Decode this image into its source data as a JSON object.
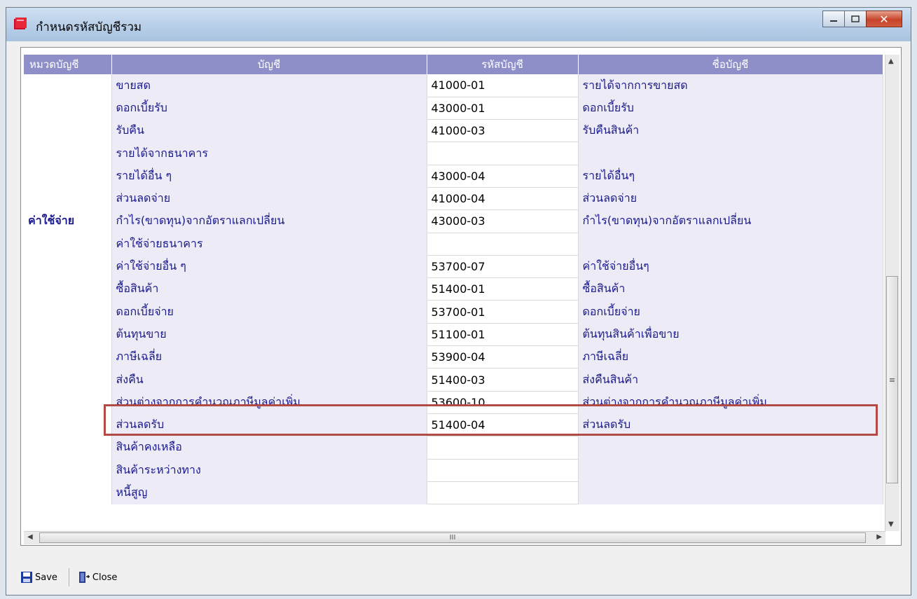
{
  "window": {
    "title": "กำหนดรหัสบัญชีรวม"
  },
  "columns": [
    "หมวดบัญชี",
    "บัญชี",
    "รหัสบัญชี",
    "ชื่อบัญชี"
  ],
  "rows": [
    {
      "cat": "",
      "acct": "ขายสด",
      "code": "41000-01",
      "name": "รายได้จากการขายสด"
    },
    {
      "cat": "",
      "acct": "ดอกเบี้ยรับ",
      "code": "43000-01",
      "name": "ดอกเบี้ยรับ"
    },
    {
      "cat": "",
      "acct": "รับคืน",
      "code": "41000-03",
      "name": "รับคืนสินค้า"
    },
    {
      "cat": "",
      "acct": "รายได้จากธนาคาร",
      "code": "",
      "name": ""
    },
    {
      "cat": "",
      "acct": "รายได้อื่น ๆ",
      "code": "43000-04",
      "name": "รายได้อื่นๆ"
    },
    {
      "cat": "",
      "acct": "ส่วนลดจ่าย",
      "code": "41000-04",
      "name": "ส่วนลดจ่าย"
    },
    {
      "cat": "ค่าใช้จ่าย",
      "acct": "กำไร(ขาดทุน)จากอัตราแลกเปลี่ยน",
      "code": "43000-03",
      "name": "กำไร(ขาดทุน)จากอัตราแลกเปลี่ยน"
    },
    {
      "cat": "",
      "acct": "ค่าใช้จ่ายธนาคาร",
      "code": "",
      "name": ""
    },
    {
      "cat": "",
      "acct": "ค่าใช้จ่ายอื่น ๆ",
      "code": "53700-07",
      "name": "ค่าใช้จ่ายอื่นๆ"
    },
    {
      "cat": "",
      "acct": "ซื้อสินค้า",
      "code": "51400-01",
      "name": "ซื้อสินค้า"
    },
    {
      "cat": "",
      "acct": "ดอกเบี้ยจ่าย",
      "code": "53700-01",
      "name": "ดอกเบี้ยจ่าย"
    },
    {
      "cat": "",
      "acct": "ต้นทุนขาย",
      "code": "51100-01",
      "name": "ต้นทุนสินค้าเพื่อขาย"
    },
    {
      "cat": "",
      "acct": "ภาษีเฉลี่ย",
      "code": "53900-04",
      "name": "ภาษีเฉลี่ย"
    },
    {
      "cat": "",
      "acct": "ส่งคืน",
      "code": "51400-03",
      "name": "ส่งคืนสินค้า"
    },
    {
      "cat": "",
      "acct": "ส่วนต่างจากการคำนวณภาษีมูลค่าเพิ่ม",
      "code": "53600-10",
      "name": "ส่วนต่างจากการคำนวณภาษีมูลค่าเพิ่ม"
    },
    {
      "cat": "",
      "acct": "ส่วนลดรับ",
      "code": "51400-04",
      "name": "ส่วนลดรับ"
    },
    {
      "cat": "",
      "acct": "สินค้าคงเหลือ",
      "code": "",
      "name": ""
    },
    {
      "cat": "",
      "acct": "สินค้าระหว่างทาง",
      "code": "",
      "name": ""
    },
    {
      "cat": "",
      "acct": "หนี้สูญ",
      "code": "",
      "name": ""
    }
  ],
  "toolbar": {
    "save_label": "Save",
    "close_label": "Close"
  },
  "highlight_color": "#b24a45",
  "header_color": "#8e8ec8"
}
